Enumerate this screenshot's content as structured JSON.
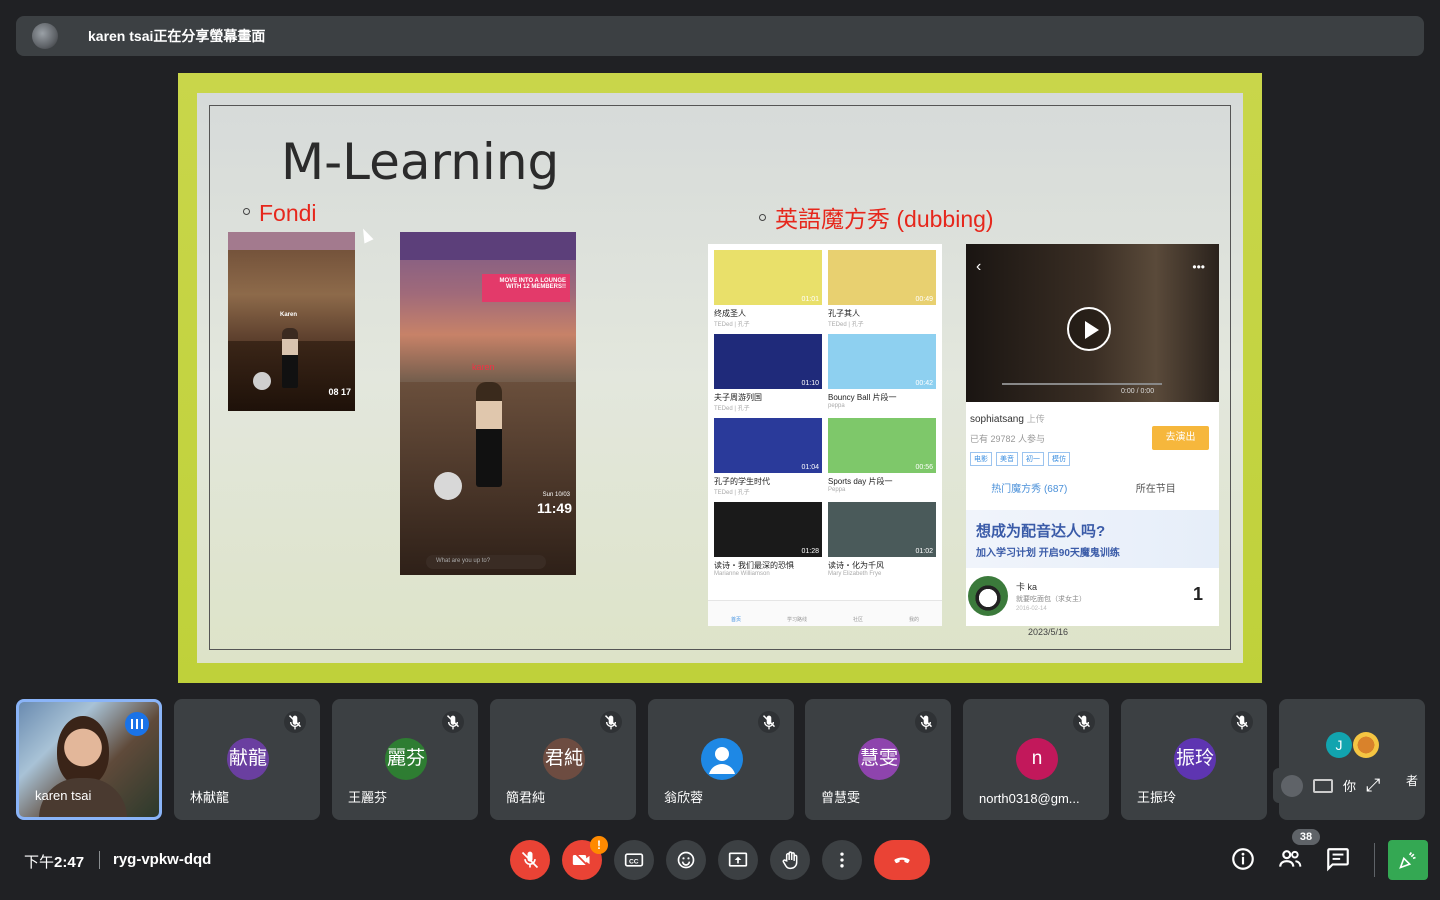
{
  "banner": {
    "text": "karen tsai正在分享螢幕畫面"
  },
  "slide": {
    "title": "M-Learning",
    "bullet_left": "Fondi",
    "bullet_right": "英語魔方秀 (dubbing)",
    "date": "2023/5/16",
    "fondi_left": {
      "name": "Karen",
      "time": "08 17"
    },
    "fondi_right": {
      "banner": "MOVE INTO A LOUNGE WITH 12 MEMBERS!!",
      "name": "karen",
      "date": "Sun 10/03",
      "time": "11:49",
      "input": "What are you up to?"
    },
    "dubbing_list": {
      "tiles": [
        {
          "title": "终成圣人",
          "sub": "TEDed | 孔子",
          "duration": "01:01",
          "color": "#e9e06a"
        },
        {
          "title": "孔子其人",
          "sub": "TEDed | 孔子",
          "duration": "00:49",
          "color": "#e8d070"
        },
        {
          "title": "夫子周游列国",
          "sub": "TEDed | 孔子",
          "duration": "01:10",
          "color": "#1f2a7a"
        },
        {
          "title": "Bouncy Ball 片段一",
          "sub": "peppa",
          "duration": "00:42",
          "color": "#8ed0f0"
        },
        {
          "title": "孔子的学生时代",
          "sub": "TEDed | 孔子",
          "duration": "01:04",
          "color": "#2a3a9a"
        },
        {
          "title": "Sports day 片段一",
          "sub": "Peppa",
          "duration": "00:56",
          "color": "#7ec86a"
        },
        {
          "title": "读诗・我们最深的恐惧",
          "sub": "Marianne Williamson",
          "duration": "01:28",
          "color": "#1a1a1a"
        },
        {
          "title": "读诗・化为千风",
          "sub": "Mary Elizabeth Frye",
          "duration": "01:02",
          "color": "#4a5a5a"
        }
      ],
      "nav": [
        "首页",
        "学习路线",
        "社区",
        "我的"
      ]
    },
    "dubbing_detail": {
      "time": "0:00 / 0:00",
      "uploader": "sophiatsang",
      "uploader_suffix": "上传",
      "joined": "已有 29782 人参与",
      "action": "去演出",
      "tags": [
        "电影",
        "美音",
        "初一",
        "模仿"
      ],
      "tab_hot": "热门魔方秀 (687)",
      "tab_program": "所在节目",
      "ad_title": "想成为配音达人吗?",
      "ad_sub": "加入学习计划 开启90天魔鬼训练",
      "row_name": "卡 ka",
      "row_sub": "就要吃面包（求女主）",
      "row_date": "2016-02-14",
      "row_rank": "1"
    }
  },
  "participants": [
    {
      "name": "karen tsai",
      "speaking": true
    },
    {
      "name": "林献龍",
      "initials": "献龍",
      "color": "#6a3fa0"
    },
    {
      "name": "王麗芬",
      "initials": "麗芬",
      "color": "#2e7d32"
    },
    {
      "name": "簡君純",
      "initials": "君純",
      "color": "#6d4c41"
    },
    {
      "name": "翁欣蓉",
      "initials": "",
      "color": "#1e88e5"
    },
    {
      "name": "曾慧雯",
      "initials": "慧雯",
      "color": "#8e44ad"
    },
    {
      "name": "north0318@gm...",
      "initials": "n",
      "color": "#c2185b"
    },
    {
      "name": "王振玲",
      "initials": "振玲",
      "color": "#5e35b1"
    }
  ],
  "more_tile": {
    "initial": "J",
    "self_label": "你",
    "other": "者"
  },
  "bottom": {
    "time_prefix": "下午",
    "time": "2:47",
    "code": "ryg-vpkw-dqd",
    "people_count": "38",
    "camera_badge": "!"
  },
  "colors": {
    "leave": "#ea4335",
    "accent": "#8ab4f8",
    "activities": "#34a853"
  }
}
